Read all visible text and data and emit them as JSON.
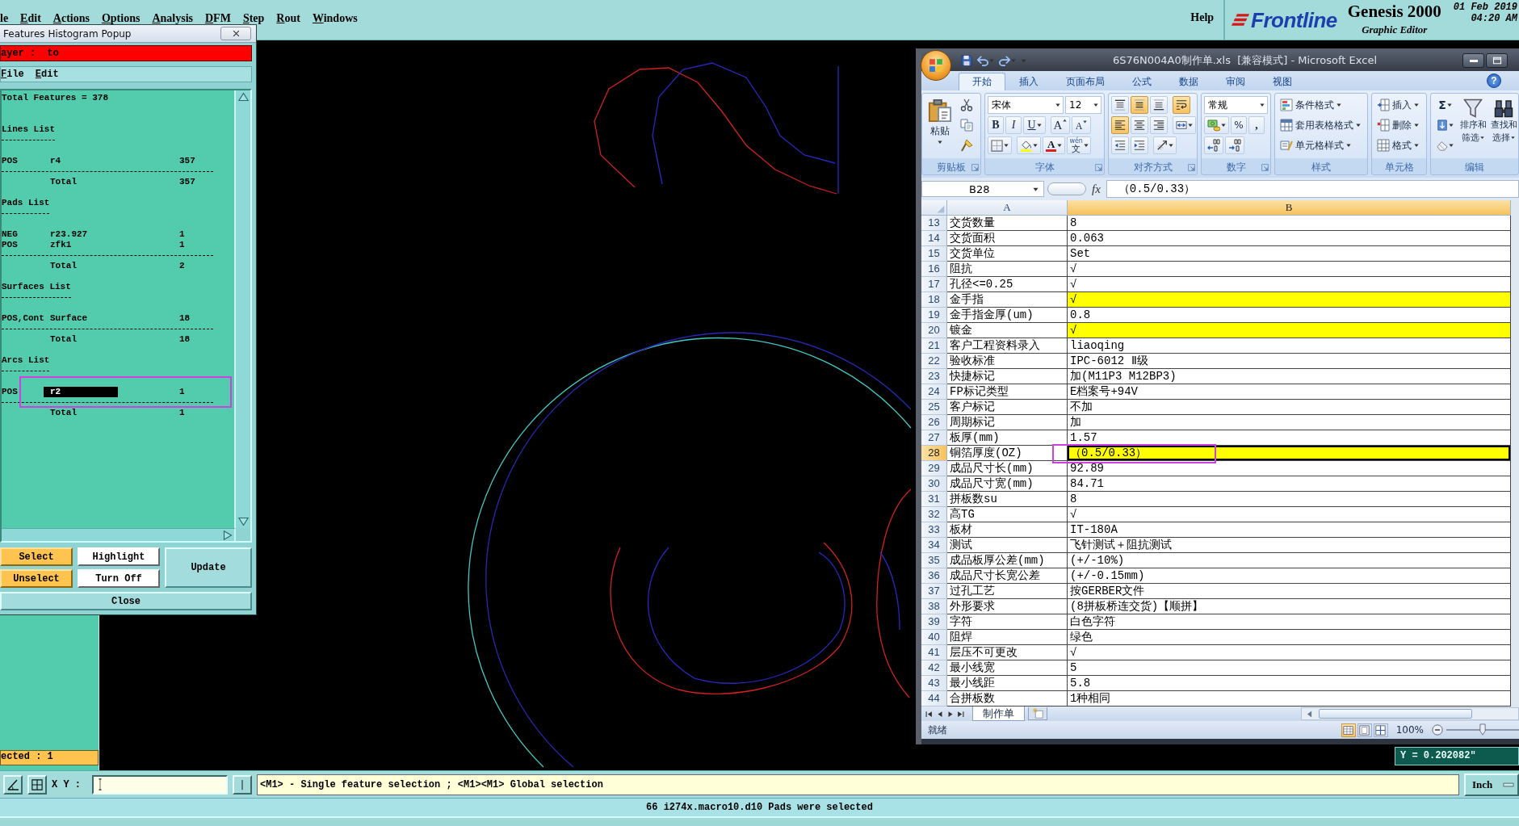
{
  "menu_bar": {
    "items": [
      "le",
      "Edit",
      "Actions",
      "Options",
      "Analysis",
      "DFM",
      "Step",
      "Rout",
      "Windows"
    ],
    "help": "Help",
    "brand": "Frontline",
    "product": "Genesis 2000",
    "subtitle": "Graphic Editor",
    "date": "01 Feb 2019",
    "time": "04:20 AM"
  },
  "features_popup": {
    "title": "Features Histogram Popup",
    "layer": "ayer :  to",
    "menu": [
      "File",
      "Edit"
    ],
    "summary": "Total Features = 378",
    "sections": [
      {
        "title": "Lines List",
        "rows": [
          {
            "polarity": "POS",
            "symbol": "r4",
            "count": "357",
            "selected": false
          }
        ],
        "total_label": "Total",
        "total": "357"
      },
      {
        "title": "Pads List",
        "rows": [
          {
            "polarity": "NEG",
            "symbol": "r23.927",
            "count": "1",
            "selected": false
          },
          {
            "polarity": "POS",
            "symbol": "zfk1",
            "count": "1",
            "selected": false
          }
        ],
        "total_label": "Total",
        "total": "2"
      },
      {
        "title": "Surfaces List",
        "rows": [
          {
            "polarity": "POS,Cont",
            "symbol": "Surface",
            "count": "18",
            "selected": false
          }
        ],
        "total_label": "Total",
        "total": "18"
      },
      {
        "title": "Arcs List",
        "rows": [
          {
            "polarity": "POS",
            "symbol": "r2",
            "count": "1",
            "selected": true
          }
        ],
        "total_label": "Total",
        "total": "1"
      }
    ],
    "buttons": [
      {
        "label": "Select",
        "kind": "action"
      },
      {
        "label": "Highlight",
        "kind": "toggle"
      },
      {
        "label": "Unselect",
        "kind": "action"
      },
      {
        "label": "Turn Off",
        "kind": "toggle"
      },
      {
        "label": "Update",
        "kind": "plain"
      }
    ],
    "close": "Close"
  },
  "excel_window": {
    "title": "6S76N004A0制作单.xls  [兼容模式] - Microsoft Excel",
    "ribbon": {
      "tabs": [
        {
          "label": "开始",
          "selected": true
        },
        {
          "label": "插入",
          "selected": false
        },
        {
          "label": "页面布局",
          "selected": false
        },
        {
          "label": "公式",
          "selected": false
        },
        {
          "label": "数据",
          "selected": false
        },
        {
          "label": "审阅",
          "selected": false
        },
        {
          "label": "视图",
          "selected": false
        }
      ],
      "help": "?",
      "groups": [
        {
          "kind": "clipboard",
          "label": "剪贴板",
          "paste": "粘贴"
        },
        {
          "kind": "font",
          "label": "字体",
          "font_name": "宋体",
          "font_size": "12",
          "bold": "B",
          "italic": "I",
          "underline": "U",
          "grow": "A",
          "shrink": "A",
          "font_color": "A",
          "phonetic_top": "wén",
          "phonetic": "文"
        },
        {
          "kind": "alignment",
          "label": "对齐方式",
          "buttons": [
            {
              "kind": "top",
              "selected": false
            },
            {
              "kind": "middle",
              "selected": true
            },
            {
              "kind": "bottom",
              "selected": false
            },
            {
              "kind": "wrap",
              "selected": true
            },
            {
              "kind": "left",
              "selected": true
            },
            {
              "kind": "center",
              "selected": false
            },
            {
              "kind": "right",
              "selected": false
            },
            {
              "kind": "merge",
              "selected": false
            },
            {
              "kind": "outdent",
              "selected": false
            },
            {
              "kind": "indent",
              "selected": false
            },
            {
              "kind": "orientation",
              "selected": false
            }
          ]
        },
        {
          "kind": "number",
          "label": "数字",
          "format": "常规",
          "percent": "%",
          "comma": ","
        },
        {
          "kind": "styles",
          "label": "样式",
          "items": [
            "条件格式",
            "套用表格格式",
            "单元格样式"
          ]
        },
        {
          "kind": "cells",
          "label": "单元格",
          "items": [
            "插入",
            "删除",
            "格式"
          ]
        },
        {
          "kind": "editing",
          "label": "编辑",
          "sum": "Σ",
          "sort": [
            "排序和",
            "筛选"
          ],
          "find": [
            "查找和",
            "选择"
          ]
        }
      ]
    },
    "name_box": "B28",
    "function_label": "fx",
    "formula": "（0.5/0.33）",
    "columns": [
      {
        "label": "A",
        "selected": false
      },
      {
        "label": "B",
        "selected": true
      }
    ],
    "rows": [
      {
        "number": "13",
        "label": "交货数量",
        "value": "8",
        "highlighted": false,
        "selected": false
      },
      {
        "number": "14",
        "label": "交货面积",
        "value": "0.063",
        "highlighted": false,
        "selected": false
      },
      {
        "number": "15",
        "label": "交货单位",
        "value": "Set",
        "highlighted": false,
        "selected": false
      },
      {
        "number": "16",
        "label": "阻抗",
        "value": "√",
        "highlighted": false,
        "selected": false
      },
      {
        "number": "17",
        "label": "孔径<=0.25",
        "value": "√",
        "highlighted": false,
        "selected": false
      },
      {
        "number": "18",
        "label": "金手指",
        "value": "√",
        "highlighted": true,
        "selected": false
      },
      {
        "number": "19",
        "label": "金手指金厚(um)",
        "value": "0.8",
        "highlighted": false,
        "selected": false
      },
      {
        "number": "20",
        "label": "镀金",
        "value": "√",
        "highlighted": true,
        "selected": false
      },
      {
        "number": "21",
        "label": "客户工程资料录入",
        "value": "liaoqing",
        "highlighted": false,
        "selected": false
      },
      {
        "number": "22",
        "label": "验收标准",
        "value": "IPC-6012 Ⅱ级",
        "highlighted": false,
        "selected": false
      },
      {
        "number": "23",
        "label": "快捷标记",
        "value": "加(M11P3 M12BP3)",
        "highlighted": false,
        "selected": false
      },
      {
        "number": "24",
        "label": "FP标记类型",
        "value": "E档案号+94V",
        "highlighted": false,
        "selected": false
      },
      {
        "number": "25",
        "label": "客户标记",
        "value": "不加",
        "highlighted": false,
        "selected": false
      },
      {
        "number": "26",
        "label": "周期标记",
        "value": "加",
        "highlighted": false,
        "selected": false
      },
      {
        "number": "27",
        "label": "板厚(mm)",
        "value": "1.57",
        "highlighted": false,
        "selected": false
      },
      {
        "number": "28",
        "label": "铜箔厚度(OZ)",
        "value": "（0.5/0.33）",
        "highlighted": true,
        "selected": true
      },
      {
        "number": "29",
        "label": "成品尺寸长(mm)",
        "value": "92.89",
        "highlighted": false,
        "selected": false
      },
      {
        "number": "30",
        "label": "成品尺寸宽(mm)",
        "value": "84.71",
        "highlighted": false,
        "selected": false
      },
      {
        "number": "31",
        "label": "拼板数su",
        "value": "8",
        "highlighted": false,
        "selected": false
      },
      {
        "number": "32",
        "label": "高TG",
        "value": "√",
        "highlighted": false,
        "selected": false
      },
      {
        "number": "33",
        "label": "板材",
        "value": "IT-180A",
        "highlighted": false,
        "selected": false
      },
      {
        "number": "34",
        "label": "测试",
        "value": "飞针测试＋阻抗测试",
        "highlighted": false,
        "selected": false
      },
      {
        "number": "35",
        "label": "成品板厚公差(mm)",
        "value": "(+/-10%)",
        "highlighted": false,
        "selected": false
      },
      {
        "number": "36",
        "label": "成品尺寸长宽公差",
        "value": "(+/-0.15mm)",
        "highlighted": false,
        "selected": false
      },
      {
        "number": "37",
        "label": "过孔工艺",
        "value": "按GERBER文件",
        "highlighted": false,
        "selected": false
      },
      {
        "number": "38",
        "label": "外形要求",
        "value": "(8拼板桥连交货)【顺拼】",
        "highlighted": false,
        "selected": false
      },
      {
        "number": "39",
        "label": "字符",
        "value": "白色字符",
        "highlighted": false,
        "selected": false
      },
      {
        "number": "40",
        "label": "阻焊",
        "value": "绿色",
        "highlighted": false,
        "selected": false
      },
      {
        "number": "41",
        "label": "层压不可更改",
        "value": "√",
        "highlighted": false,
        "selected": false
      },
      {
        "number": "42",
        "label": "最小线宽",
        "value": "5",
        "highlighted": false,
        "selected": false
      },
      {
        "number": "43",
        "label": "最小线距",
        "value": "5.8",
        "highlighted": false,
        "selected": false
      },
      {
        "number": "44",
        "label": "合拼板数",
        "value": "1种相同",
        "highlighted": false,
        "selected": false
      }
    ],
    "sheet_tabs": [
      {
        "label": "制作单",
        "selected": true
      }
    ],
    "status": "就绪",
    "views": [
      {
        "kind": "normal",
        "selected": true
      },
      {
        "kind": "layout",
        "selected": false
      },
      {
        "kind": "break",
        "selected": false
      }
    ],
    "zoom": "100%",
    "zoom_slider": {
      "level": 0.5
    }
  },
  "left_panel": {
    "selection": "ected : 1"
  },
  "readout": "Y = 0.202082\"",
  "command_bar": {
    "label": "X Y :",
    "message": "<M1> - Single feature selection ; <M1><M1> Global selection",
    "units": "Inch"
  },
  "status_bar": {
    "message": "66 i274x.macro10.d10 Pads were selected"
  }
}
